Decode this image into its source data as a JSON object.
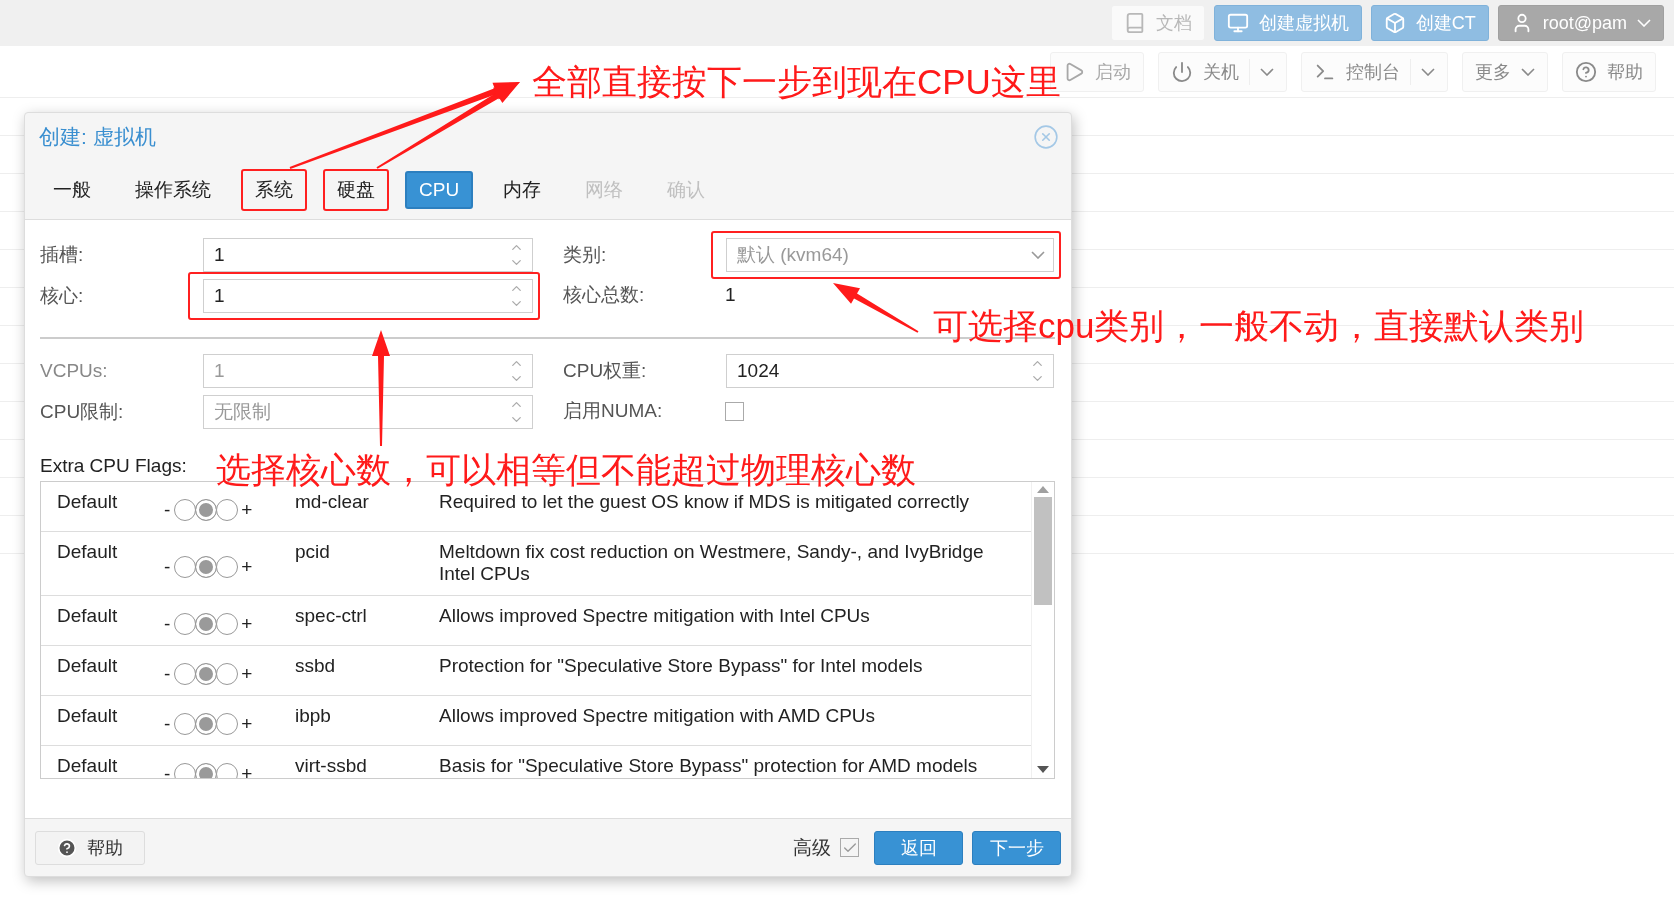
{
  "top_bar": {
    "buttons": [
      {
        "label": "文档",
        "kind": "plain"
      },
      {
        "label": "创建虚拟机",
        "kind": "primary"
      },
      {
        "label": "创建CT",
        "kind": "primary"
      },
      {
        "label": "root@pam",
        "kind": "user"
      }
    ]
  },
  "toolbar": {
    "buttons": [
      {
        "label": "启动",
        "disabled": true,
        "kind": "plain"
      },
      {
        "label": "关机",
        "disabled": false,
        "kind": "split"
      },
      {
        "label": "控制台",
        "disabled": false,
        "kind": "split"
      },
      {
        "label": "更多",
        "disabled": false,
        "kind": "menu"
      },
      {
        "label": "帮助",
        "disabled": false,
        "kind": "plain"
      }
    ]
  },
  "dialog": {
    "title": "创建: 虚拟机",
    "tabs": [
      {
        "label": "一般",
        "selected": false,
        "disabled": false,
        "highlighted": false
      },
      {
        "label": "操作系统",
        "selected": false,
        "disabled": false,
        "highlighted": false
      },
      {
        "label": "系统",
        "selected": false,
        "disabled": false,
        "highlighted": true
      },
      {
        "label": "硬盘",
        "selected": false,
        "disabled": false,
        "highlighted": true
      },
      {
        "label": "CPU",
        "selected": true,
        "disabled": false,
        "highlighted": false
      },
      {
        "label": "内存",
        "selected": false,
        "disabled": false,
        "highlighted": false
      },
      {
        "label": "网络",
        "selected": false,
        "disabled": true,
        "highlighted": false
      },
      {
        "label": "确认",
        "selected": false,
        "disabled": true,
        "highlighted": false
      }
    ],
    "form_top": [
      {
        "label": "插槽:",
        "kind": "spinner",
        "value": "1",
        "disabled": false,
        "highlighted": false
      },
      {
        "label": "类别:",
        "kind": "combo",
        "placeholder": "默认 (kvm64)",
        "disabled": false,
        "highlighted": true
      },
      {
        "label": "核心:",
        "kind": "spinner",
        "value": "1",
        "disabled": false,
        "highlighted": true
      },
      {
        "label": "核心总数:",
        "kind": "display",
        "value": "1"
      }
    ],
    "form_bottom": [
      {
        "label": "VCPUs:",
        "kind": "spinner",
        "value": "1",
        "disabled": true,
        "highlighted": false
      },
      {
        "label": "CPU权重:",
        "kind": "spinner",
        "value": "1024",
        "disabled": false,
        "highlighted": false
      },
      {
        "label": "CPU限制:",
        "kind": "spinner",
        "placeholder": "无限制",
        "highlighted": false
      },
      {
        "label": "启用NUMA:",
        "kind": "checkbox",
        "checked": false
      }
    ],
    "flags_label": "Extra CPU Flags:",
    "flags": [
      {
        "setting": "Default",
        "minus": "-",
        "options": [
          {
            "selected": false
          },
          {
            "selected": true
          },
          {
            "selected": false
          }
        ],
        "plus": "+",
        "flag": "md-clear",
        "description": "Required to let the guest OS know if MDS is mitigated correctly"
      },
      {
        "setting": "Default",
        "minus": "-",
        "options": [
          {
            "selected": false
          },
          {
            "selected": true
          },
          {
            "selected": false
          }
        ],
        "plus": "+",
        "flag": "pcid",
        "description": "Meltdown fix cost reduction on Westmere, Sandy-, and IvyBridge Intel CPUs"
      },
      {
        "setting": "Default",
        "minus": "-",
        "options": [
          {
            "selected": false
          },
          {
            "selected": true
          },
          {
            "selected": false
          }
        ],
        "plus": "+",
        "flag": "spec-ctrl",
        "description": "Allows improved Spectre mitigation with Intel CPUs"
      },
      {
        "setting": "Default",
        "minus": "-",
        "options": [
          {
            "selected": false
          },
          {
            "selected": true
          },
          {
            "selected": false
          }
        ],
        "plus": "+",
        "flag": "ssbd",
        "description": "Protection for \"Speculative Store Bypass\" for Intel models"
      },
      {
        "setting": "Default",
        "minus": "-",
        "options": [
          {
            "selected": false
          },
          {
            "selected": true
          },
          {
            "selected": false
          }
        ],
        "plus": "+",
        "flag": "ibpb",
        "description": "Allows improved Spectre mitigation with AMD CPUs"
      },
      {
        "setting": "Default",
        "minus": "-",
        "options": [
          {
            "selected": false
          },
          {
            "selected": true
          },
          {
            "selected": false
          }
        ],
        "plus": "+",
        "flag": "virt-ssbd",
        "description": "Basis for \"Speculative Store Bypass\" protection for AMD models"
      }
    ],
    "footer": {
      "help": "帮助",
      "advanced": {
        "label": "高级",
        "checked": true
      },
      "back": "返回",
      "next": "下一步"
    }
  },
  "annotations": [
    {
      "text": "全部直接按下一步到现在CPU这里"
    },
    {
      "text": "可选择cpu类别，一般不动，直接默认类别"
    },
    {
      "text": "选择核心数，可以相等但不能超过物理核心数"
    }
  ]
}
